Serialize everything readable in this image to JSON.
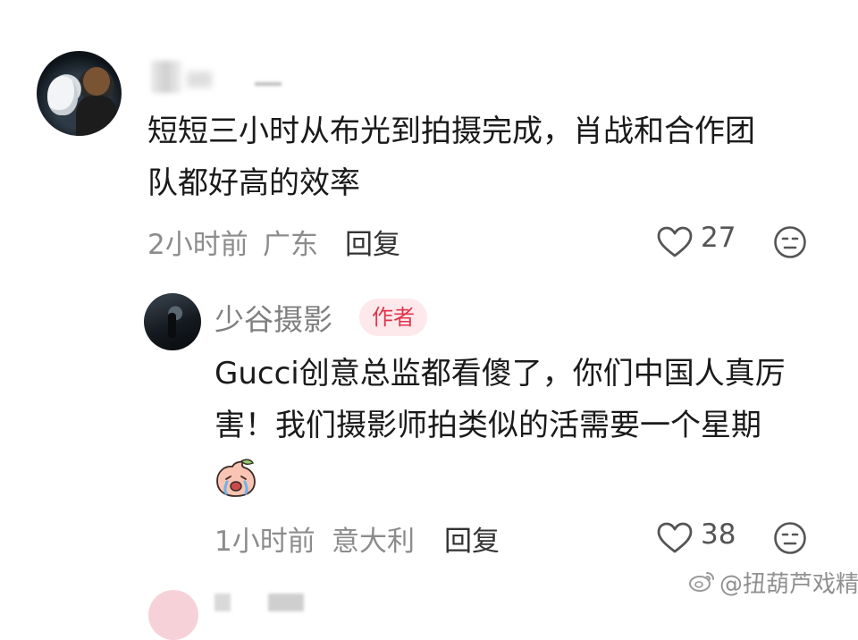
{
  "comments": [
    {
      "text": "短短三小时从布光到拍摄完成，肖战和合作团\n队都好高的效率",
      "time": "2小时前",
      "location": "广东",
      "reply_label": "回复",
      "likes": "27"
    },
    {
      "author": "少谷摄影",
      "badge": "作者",
      "text": "Gucci创意总监都看傻了，你们中国人真厉\n害！我们摄影师拍类似的活需要一个星期",
      "time": "1小时前",
      "location": "意大利",
      "reply_label": "回复",
      "likes": "38"
    }
  ],
  "watermark": "@扭葫芦戏精",
  "icons": {
    "like": "heart-outline-icon",
    "react": "face-icon",
    "emoji": "crying-peach-emoji",
    "watermark": "weibo-icon"
  },
  "colors": {
    "badge_bg": "#fde9ec",
    "badge_text": "#e0354b",
    "meta_text": "#8c8c8c"
  }
}
